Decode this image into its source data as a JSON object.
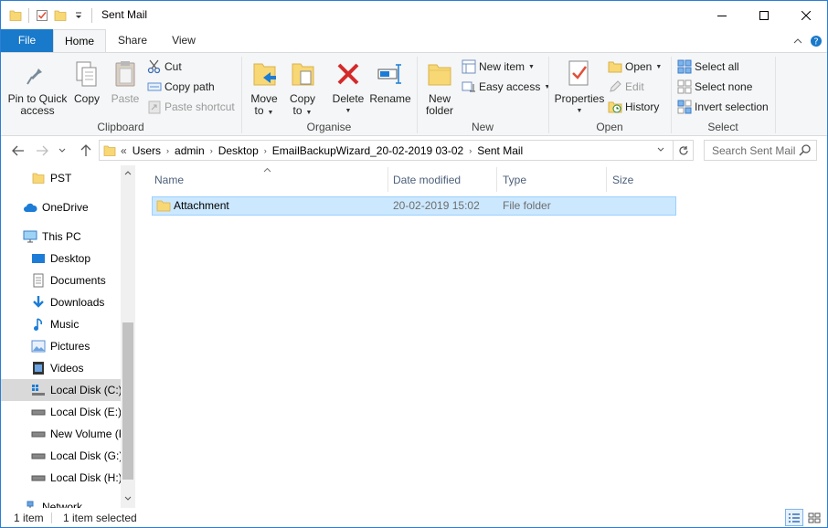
{
  "window": {
    "title": "Sent Mail"
  },
  "tabs": {
    "file": "File",
    "home": "Home",
    "share": "Share",
    "view": "View"
  },
  "ribbon": {
    "clipboard": {
      "label": "Clipboard",
      "pin_line1": "Pin to Quick",
      "pin_line2": "access",
      "copy": "Copy",
      "paste": "Paste",
      "cut": "Cut",
      "copy_path": "Copy path",
      "paste_shortcut": "Paste shortcut"
    },
    "organise": {
      "label": "Organise",
      "move_line1": "Move",
      "move_line2": "to",
      "copy_line1": "Copy",
      "copy_line2": "to",
      "delete": "Delete",
      "rename": "Rename"
    },
    "new": {
      "label": "New",
      "folder_line1": "New",
      "folder_line2": "folder",
      "new_item": "New item",
      "easy_access": "Easy access"
    },
    "open": {
      "label": "Open",
      "properties": "Properties",
      "open": "Open",
      "edit": "Edit",
      "history": "History"
    },
    "select": {
      "label": "Select",
      "select_all": "Select all",
      "select_none": "Select none",
      "invert": "Invert selection"
    }
  },
  "address": {
    "overflow": "«",
    "crumbs": [
      "Users",
      "admin",
      "Desktop",
      "EmailBackupWizard_20-02-2019 03-02",
      "Sent Mail"
    ]
  },
  "search": {
    "placeholder": "Search Sent Mail"
  },
  "nav": {
    "items": [
      "PST",
      "OneDrive",
      "This PC",
      "Desktop",
      "Documents",
      "Downloads",
      "Music",
      "Pictures",
      "Videos",
      "Local Disk (C:)",
      "Local Disk (E:)",
      "New Volume (F:)",
      "Local Disk (G:)",
      "Local Disk (H:)",
      "Network"
    ]
  },
  "columns": {
    "name": "Name",
    "date": "Date modified",
    "type": "Type",
    "size": "Size"
  },
  "files": [
    {
      "name": "Attachment",
      "date": "20-02-2019 15:02",
      "type": "File folder",
      "size": ""
    }
  ],
  "status": {
    "count": "1 item",
    "selected": "1 item selected"
  },
  "colors": {
    "accent": "#1979ca",
    "selection": "#cce8ff",
    "folder": "#f8d775"
  }
}
